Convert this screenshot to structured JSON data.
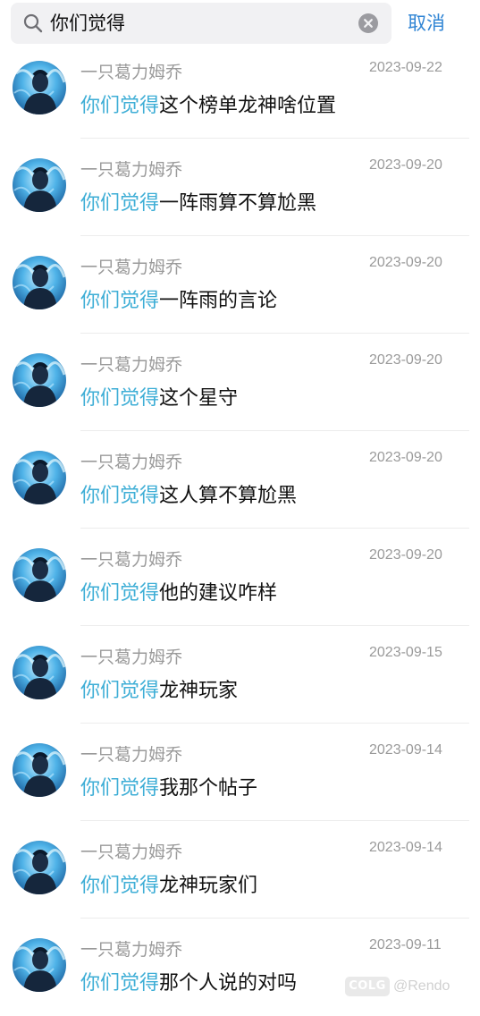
{
  "search": {
    "query": "你们觉得",
    "cancel_label": "取消",
    "icon": "search-icon",
    "clear_icon": "clear-icon"
  },
  "colors": {
    "highlight": "#3eaed6",
    "accent": "#2f84d4",
    "meta_text": "#9a9a9a",
    "title_text": "#111111"
  },
  "results": [
    {
      "author": "一只葛力姆乔",
      "date": "2023-09-22",
      "highlight": "你们觉得",
      "rest": "这个榜单龙神啥位置"
    },
    {
      "author": "一只葛力姆乔",
      "date": "2023-09-20",
      "highlight": "你们觉得",
      "rest": "一阵雨算不算尬黑"
    },
    {
      "author": "一只葛力姆乔",
      "date": "2023-09-20",
      "highlight": "你们觉得",
      "rest": "一阵雨的言论"
    },
    {
      "author": "一只葛力姆乔",
      "date": "2023-09-20",
      "highlight": "你们觉得",
      "rest": "这个星守"
    },
    {
      "author": "一只葛力姆乔",
      "date": "2023-09-20",
      "highlight": "你们觉得",
      "rest": "这人算不算尬黑"
    },
    {
      "author": "一只葛力姆乔",
      "date": "2023-09-20",
      "highlight": "你们觉得",
      "rest": "他的建议咋样"
    },
    {
      "author": "一只葛力姆乔",
      "date": "2023-09-15",
      "highlight": "你们觉得",
      "rest": "龙神玩家"
    },
    {
      "author": "一只葛力姆乔",
      "date": "2023-09-14",
      "highlight": "你们觉得",
      "rest": "我那个帖子"
    },
    {
      "author": "一只葛力姆乔",
      "date": "2023-09-14",
      "highlight": "你们觉得",
      "rest": "龙神玩家们"
    },
    {
      "author": "一只葛力姆乔",
      "date": "2023-09-11",
      "highlight": "你们觉得",
      "rest": "那个人说的对吗"
    }
  ],
  "watermark": {
    "logo": "COLG",
    "user": "@Rendo"
  }
}
